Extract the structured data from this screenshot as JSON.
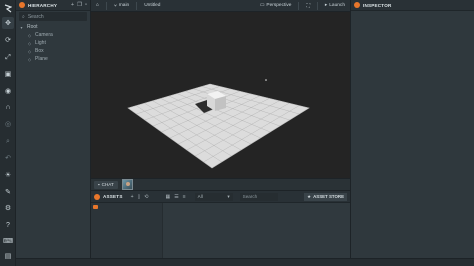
{
  "hierarchy": {
    "title": "HIERARCHY",
    "search_placeholder": "Search",
    "root": "Root",
    "children": [
      "Camera",
      "Light",
      "Box",
      "Plane"
    ]
  },
  "topbar": {
    "branch": "main",
    "scene": "Untitled",
    "view_mode": "Perspective",
    "launch": "Launch"
  },
  "chat": {
    "label": "CHAT"
  },
  "assets": {
    "title": "ASSETS",
    "filter": "All",
    "search_placeholder": "Search",
    "store": "ASSET STORE"
  },
  "inspector": {
    "title": "INSPECTOR"
  },
  "colors": {
    "accent": "#e8762b",
    "panel": "#2f383d",
    "toolbar": "#262d31",
    "viewport": "#242424",
    "grid_plane": "#dcdcdc"
  },
  "icons": {
    "toolbar": [
      "move",
      "rotate",
      "scale",
      "resize",
      "world",
      "magnet",
      "eye",
      "search",
      "undo",
      "bulb",
      "pen",
      "gear",
      "help",
      "keyboard",
      "user"
    ]
  }
}
